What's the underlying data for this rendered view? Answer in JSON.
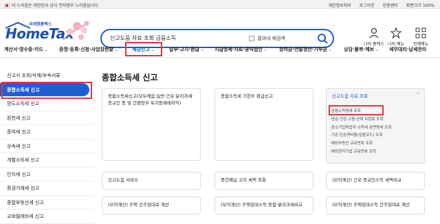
{
  "topbar": {
    "notice": "이 누리집은 대한민국 공식 전자정부 누리집입니다.",
    "links": [
      "개인정보처리",
      "로그아웃",
      "인증센터",
      "화면크기 100%"
    ]
  },
  "logo": {
    "sub": "국세청홈택스",
    "main": "HomeTax"
  },
  "search": {
    "query": "신고도움 자료 조회 금융소득",
    "checkbox_label": "결과내 재검색"
  },
  "quick": [
    {
      "label": "나의 홈택스"
    },
    {
      "label": "나의 메뉴"
    },
    {
      "label": "전체메뉴"
    }
  ],
  "gnb": [
    "계산서·영수증·카드",
    "증명·등록·신청·사업장현황",
    "세금신고",
    "납부·고지·환급",
    "지급명세·자료·공익법인",
    "장려금·연말정산·기부금",
    "상담·불복·제보",
    "세무대리·납세관리"
  ],
  "lnb": [
    "신고서 조회/삭제/부속서류",
    "종합소득세 신고",
    "양도소득세 신고",
    "원천세 신고",
    "증여세 신고",
    "상속세 신고",
    "개별소비세 신고",
    "인지세 신고",
    "증권거래세 신고",
    "종합부동산세 신고",
    "교육텔레비세 신고"
  ],
  "main": {
    "title": "종합소득세 신고",
    "cards": [
      "종합소득세신고(모두채움·일반·근로·분리과세·종교인 등 및 간편장부·토지등매매차익)",
      "종합소득세 기한후 환급신고",
      "신고도움 자료 조회",
      "신고도움 서비스",
      "중간예납 고지 세액 조회",
      "(모의계산) 근로·종교인소득 세액비교",
      "(모의계산) 주택 간주임대료 계산",
      "(모의계산) 주택임대소득 종합·분리과세비교",
      "(모의계산) 주택임대소득 간주임대료 계산"
    ],
    "sublist": [
      "금융소득명세 조회",
      "연금·건강·고용·산재 보험료 조회",
      "중소기업취업자 소득세 감면명세 조회",
      "기준·단순경비율(업종코드) 조회",
      "해외부동산 교유번호 조회",
      "해외현지기업 교유번호 조회"
    ]
  }
}
